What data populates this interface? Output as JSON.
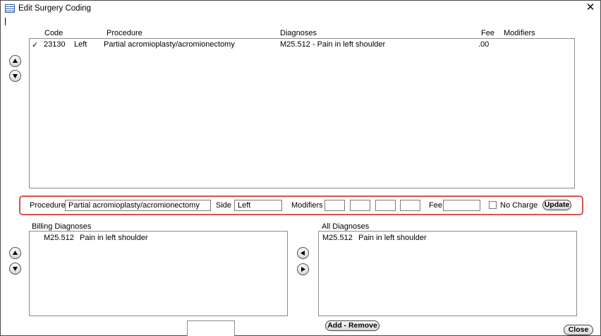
{
  "window": {
    "title": "Edit Surgery Coding",
    "close_glyph": "✕"
  },
  "procedure_grid": {
    "columns": {
      "code": "Code",
      "procedure": "Procedure",
      "diagnoses": "Diagnoses",
      "fee": "Fee",
      "modifiers": "Modifiers"
    },
    "rows": [
      {
        "check": "✓",
        "code": "23130",
        "side": "Left",
        "procedure": "Partial acromioplasty/acromionectomy",
        "diagnoses": "M25.512 - Pain in left shoulder",
        "fee": ".00",
        "modifiers": ""
      }
    ]
  },
  "edit_panel": {
    "procedure_label": "Procedure",
    "procedure_value": "Partial acromioplasty/acromionectomy",
    "side_label": "Side",
    "side_value": "Left",
    "modifiers_label": "Modifiers",
    "modifier_values": [
      "",
      "",
      "",
      ""
    ],
    "fee_label": "Fee",
    "fee_value": "",
    "no_charge_label": "No Charge",
    "no_charge_checked": false,
    "update_label": "Update"
  },
  "billing_diagnoses": {
    "label": "Billing Diagnoses",
    "items": [
      {
        "code": "M25.512",
        "description": "Pain in left shoulder"
      }
    ]
  },
  "all_diagnoses": {
    "label": "All Diagnoses",
    "items": [
      {
        "code": "M25.512",
        "description": "Pain in left shoulder"
      }
    ]
  },
  "buttons": {
    "add_remove": "Add - Remove",
    "close": "Close"
  },
  "icons": {
    "app": "table-icon",
    "move_up": "arrow-up-icon",
    "move_down": "arrow-down-icon",
    "move_left": "arrow-left-icon",
    "move_right": "arrow-right-icon"
  },
  "colors": {
    "highlight_border": "#d9534f"
  }
}
